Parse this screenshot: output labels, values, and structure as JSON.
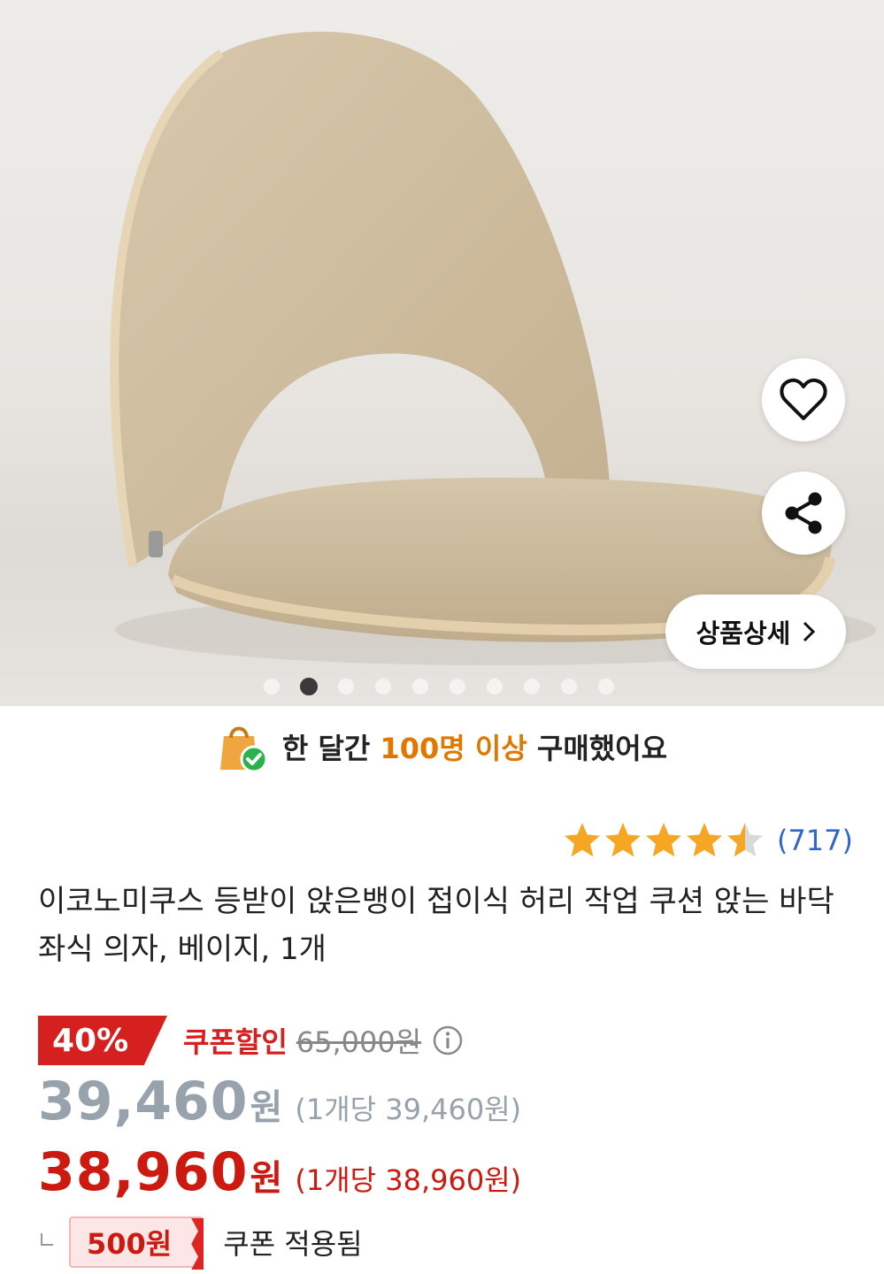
{
  "hero": {
    "dots_total": 10,
    "dots_active_index": 1,
    "detail_button_label": "상품상세"
  },
  "banner": {
    "pre": "한 달간",
    "highlight": "100명 이상",
    "post": "구매했어요",
    "highlight_color": "#e07800"
  },
  "rating": {
    "stars": 4.5,
    "count": "(717)"
  },
  "product": {
    "title": "이코노미쿠스 등받이 앉은뱅이 접이식 허리 작업 쿠션 앉는 바닥 좌식 의자, 베이지, 1개"
  },
  "price": {
    "discount_badge": "40%",
    "coupon_label": "쿠폰할인",
    "original_price": "65,000원",
    "sale_amount": "39,460",
    "sale_unit": "원",
    "sale_per_unit": "(1개당 39,460원)",
    "coupon_amount": "38,960",
    "coupon_unit": "원",
    "coupon_per_unit": "(1개당 38,960원)",
    "coupon_chip": "500원",
    "coupon_applied": "쿠폰 적용됨",
    "accent_color": "#d62020"
  }
}
